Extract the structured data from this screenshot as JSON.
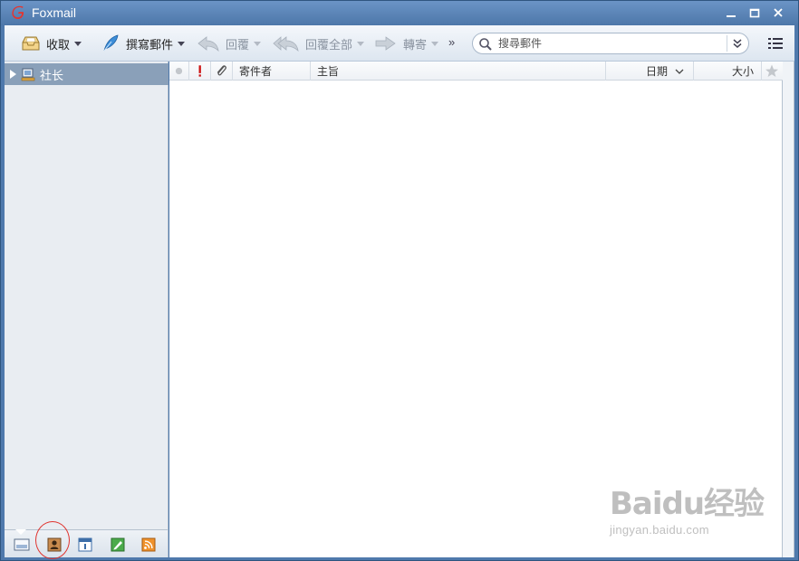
{
  "window": {
    "title": "Foxmail"
  },
  "toolbar": {
    "receive_label": "收取",
    "compose_label": "撰寫郵件",
    "reply_label": "回覆",
    "reply_all_label": "回覆全部",
    "forward_label": "轉寄",
    "more_label": "»"
  },
  "search": {
    "placeholder": "搜尋郵件"
  },
  "sidebar": {
    "folders": [
      {
        "label": "社长",
        "icon": "account-icon"
      }
    ],
    "bottom_tabs": [
      "mail-icon",
      "contacts-icon",
      "calendar-icon",
      "notes-icon",
      "rss-icon"
    ]
  },
  "mail_list": {
    "columns": {
      "sender": "寄件者",
      "subject": "主旨",
      "date": "日期",
      "size": "大小"
    },
    "rows": []
  },
  "watermark": {
    "line1": "Baidu经验",
    "line2": "jingyan.baidu.com"
  },
  "colors": {
    "titlebar": "#5880b3",
    "folder_selected": "#8aa0b9",
    "highlight_ring": "#e0332e",
    "priority": "#cc1111"
  }
}
